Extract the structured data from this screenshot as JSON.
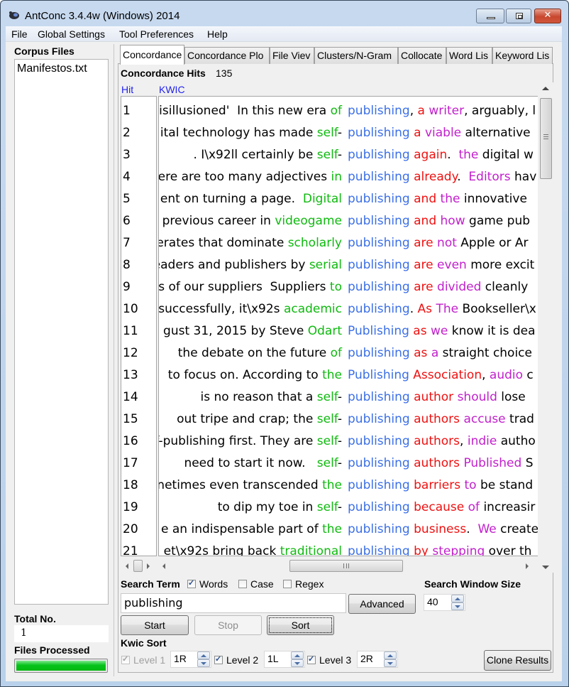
{
  "window": {
    "title": "AntConc 3.4.4w (Windows) 2014",
    "controls": {
      "minimize": "minimize",
      "maximize": "maximize",
      "close": "close"
    }
  },
  "menu": [
    "File",
    "Global Settings",
    "Tool Preferences",
    "Help"
  ],
  "left_panel": {
    "corpus_files_label": "Corpus Files",
    "files": [
      "Manifestos.txt"
    ],
    "total_no_label": "Total No.",
    "total_no_value": "1",
    "files_processed_label": "Files Processed",
    "files_processed_progress": 1.0
  },
  "tabs": [
    {
      "label": "Concordance",
      "active": true
    },
    {
      "label": "Concordance Plo",
      "active": false
    },
    {
      "label": "File Viev",
      "active": false
    },
    {
      "label": "Clusters/N-Gram",
      "active": false
    },
    {
      "label": "Collocate",
      "active": false
    },
    {
      "label": "Word Lis",
      "active": false
    },
    {
      "label": "Keyword Lis",
      "active": false
    }
  ],
  "concordance": {
    "hits_label": "Concordance Hits",
    "hits_count": "135",
    "col_hit": "Hit",
    "col_kwic": "KWIC",
    "colors": {
      "keyword": "#3b6fe6",
      "level1_1L": "#0fba0f",
      "level2_1R": "#ef1111",
      "level3_2R": "#c21fcc"
    },
    "rows": [
      {
        "hit": "1",
        "left": "isillusioned'  In this new era ",
        "l1": "of",
        "l1_suffix": "",
        "key": "publishing",
        "k_suffix": ", ",
        "r1": "a",
        "mid": " ",
        "r2": "writer",
        "rest": ", arguably, l"
      },
      {
        "hit": "2",
        "left": "ital technology has made ",
        "l1": "self",
        "l1_suffix": "-",
        "key": "publishing",
        "k_suffix": " ",
        "r1": "a",
        "mid": " ",
        "r2": "viable",
        "rest": " alternative"
      },
      {
        "hit": "3",
        "left": ". I\\x92ll certainly be ",
        "l1": "self",
        "l1_suffix": "-",
        "key": "publishing",
        "k_suffix": " ",
        "r1": "again",
        "mid": ".  ",
        "r2": "the",
        "rest": " digital w"
      },
      {
        "hit": "4",
        "left": "ere are too many adjectives ",
        "l1": "in",
        "l1_suffix": "",
        "key": "publishing",
        "k_suffix": " ",
        "r1": "already",
        "mid": ".  ",
        "r2": "Editors",
        "rest": " hav"
      },
      {
        "hit": "5",
        "left": "ent on turning a page.  ",
        "l1": "Digital",
        "l1_suffix": "",
        "key": "publishing",
        "k_suffix": " ",
        "r1": "and",
        "mid": " ",
        "r2": "the",
        "rest": " innovative"
      },
      {
        "hit": "6",
        "left": " previous career in ",
        "l1": "videogame",
        "l1_suffix": "",
        "key": "publishing",
        "k_suffix": " ",
        "r1": "and",
        "mid": " ",
        "r2": "how",
        "rest": " game pub"
      },
      {
        "hit": "7",
        "left": "erates that dominate ",
        "l1": "scholarly",
        "l1_suffix": "",
        "key": "publishing",
        "k_suffix": " ",
        "r1": "are",
        "mid": " ",
        "r2": "not",
        "rest": " Apple or Ar"
      },
      {
        "hit": "8",
        "left": "eaders and publishers by ",
        "l1": "serial",
        "l1_suffix": "",
        "key": "publishing",
        "k_suffix": " ",
        "r1": "are",
        "mid": " ",
        "r2": "even",
        "rest": " more excit"
      },
      {
        "hit": "9",
        "left": "s of our suppliers  Suppliers ",
        "l1": "to",
        "l1_suffix": "",
        "key": "publishing",
        "k_suffix": " ",
        "r1": "are",
        "mid": " ",
        "r2": "divided",
        "rest": " cleanly"
      },
      {
        "hit": "10",
        "left": " successfully, it\\x92s ",
        "l1": "academic",
        "l1_suffix": "",
        "key": "publishing",
        "k_suffix": ". ",
        "r1": "As",
        "mid": " ",
        "r2": "The",
        "rest": " Bookseller\\x"
      },
      {
        "hit": "11",
        "left": "gust 31, 2015 by Steve ",
        "l1": "Odart",
        "l1_suffix": "",
        "key": "Publishing",
        "k_suffix": " ",
        "r1": "as",
        "mid": " ",
        "r2": "we",
        "rest": " know it is dea"
      },
      {
        "hit": "12",
        "left": "the debate on the future ",
        "l1": "of",
        "l1_suffix": "",
        "key": "publishing",
        "k_suffix": " ",
        "r1": "as",
        "mid": " ",
        "r2": "a",
        "rest": " straight choice"
      },
      {
        "hit": "13",
        "left": " to focus on. According to ",
        "l1": "the",
        "l1_suffix": "",
        "key": "Publishing",
        "k_suffix": " ",
        "r1": "Association",
        "mid": ", ",
        "r2": "audio",
        "rest": " c"
      },
      {
        "hit": "14",
        "left": "is no reason that a ",
        "l1": "self",
        "l1_suffix": "-",
        "key": "publishing",
        "k_suffix": " ",
        "r1": "author",
        "mid": " ",
        "r2": "should",
        "rest": " lose"
      },
      {
        "hit": "15",
        "left": "out tripe and crap; the ",
        "l1": "self",
        "l1_suffix": "-",
        "key": "publishing",
        "k_suffix": " ",
        "r1": "authors",
        "mid": " ",
        "r2": "accuse",
        "rest": " trad"
      },
      {
        "hit": "16",
        "left": "f-publishing first. They are ",
        "l1": "self",
        "l1_suffix": "-",
        "key": "publishing",
        "k_suffix": " ",
        "r1": "authors",
        "mid": ", ",
        "r2": "indie",
        "rest": " autho"
      },
      {
        "hit": "17",
        "left": "need to start it now.   ",
        "l1": "self",
        "l1_suffix": "-",
        "key": "publishing",
        "k_suffix": " ",
        "r1": "authors",
        "mid": " ",
        "r2": "Published",
        "rest": " S"
      },
      {
        "hit": "18",
        "left": "netimes even transcended ",
        "l1": "the",
        "l1_suffix": "",
        "key": "publishing",
        "k_suffix": " ",
        "r1": "barriers",
        "mid": " ",
        "r2": "to",
        "rest": " be stand"
      },
      {
        "hit": "19",
        "left": "to dip my toe in ",
        "l1": "self",
        "l1_suffix": "-",
        "key": "publishing",
        "k_suffix": " ",
        "r1": "because",
        "mid": " ",
        "r2": "of",
        "rest": " increasir"
      },
      {
        "hit": "20",
        "left": "e an indispensable part of ",
        "l1": "the",
        "l1_suffix": "",
        "key": "publishing",
        "k_suffix": " ",
        "r1": "business",
        "mid": ".  ",
        "r2": "We",
        "rest": " create"
      },
      {
        "hit": "21",
        "left": "et\\x92s bring back ",
        "l1": "traditional",
        "l1_suffix": "",
        "key": "publishing",
        "k_suffix": " ",
        "r1": "by",
        "mid": " ",
        "r2": "stepping",
        "rest": " over th"
      }
    ]
  },
  "search": {
    "term_label": "Search Term",
    "words_label": "Words",
    "words_checked": true,
    "case_label": "Case",
    "case_checked": false,
    "regex_label": "Regex",
    "regex_checked": false,
    "term_value": "publishing",
    "advanced_label": "Advanced",
    "window_size_label": "Search Window Size",
    "window_size_value": "40",
    "start_label": "Start",
    "stop_label": "Stop",
    "sort_label": "Sort"
  },
  "kwic_sort": {
    "label": "Kwic Sort",
    "levels": [
      {
        "label": "Level 1",
        "value": "1R",
        "checked": true,
        "enabled": false
      },
      {
        "label": "Level 2",
        "value": "1L",
        "checked": true,
        "enabled": true
      },
      {
        "label": "Level 3",
        "value": "2R",
        "checked": true,
        "enabled": true
      }
    ],
    "clone_label": "Clone Results"
  }
}
